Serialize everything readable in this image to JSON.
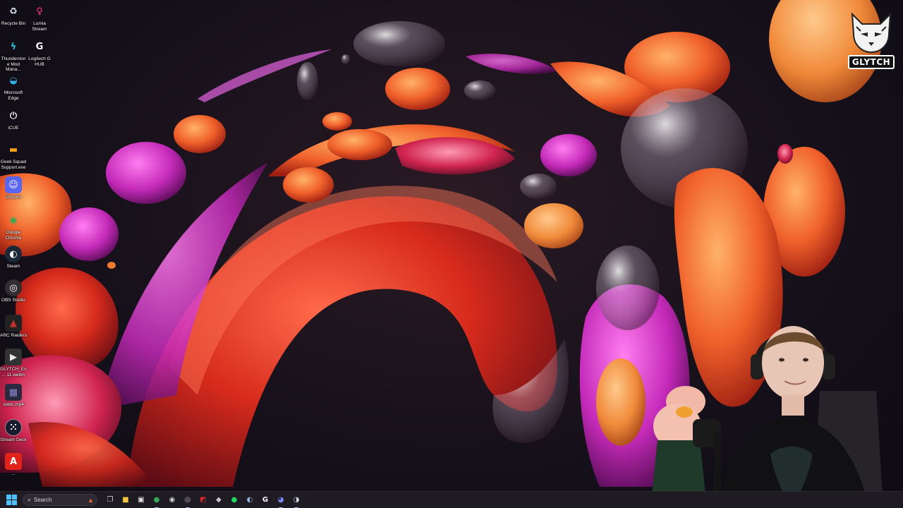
{
  "desktop": {
    "icons": [
      {
        "id": "recycle-bin",
        "label": "Recycle Bin",
        "icon": "recycle-bin-icon",
        "color": "#d9e4ef"
      },
      {
        "id": "lumia-stream",
        "label": "Lumia Stream",
        "icon": "lumia-icon",
        "color": "#ff3d7f"
      },
      {
        "id": "thunderstore",
        "label": "Thunderstore Mod Mana...",
        "icon": "thunderstore-icon",
        "color": "#23c7e0"
      },
      {
        "id": "logitech-g-hub",
        "label": "Logitech G HUB",
        "icon": "logitech-g-icon",
        "color": "#ffffff"
      },
      {
        "id": "microsoft-edge",
        "label": "Microsoft Edge",
        "icon": "edge-icon",
        "color": "#2fb1e8"
      },
      {
        "id": "icue",
        "label": "iCUE",
        "icon": "icue-icon",
        "color": "#e4e4e4"
      },
      {
        "id": "geek-squad",
        "label": "Geek Squad Support.exe",
        "icon": "geek-squad-icon",
        "color": "#f2a11b"
      },
      {
        "id": "discord",
        "label": "Discord",
        "icon": "discord-icon",
        "color": "#5865f2"
      },
      {
        "id": "google-chrome",
        "label": "Google Chrome",
        "icon": "chrome-icon",
        "color": "#34a853"
      },
      {
        "id": "steam",
        "label": "Steam",
        "icon": "steam-icon",
        "color": "#1b2838"
      },
      {
        "id": "obs-studio",
        "label": "OBS Studio",
        "icon": "obs-icon",
        "color": "#302e31"
      },
      {
        "id": "arc-raiders",
        "label": "ARC Raiders",
        "icon": "arc-raiders-icon",
        "color": "#c9302c"
      },
      {
        "id": "glytch-file",
        "label": "GLYTCH_En... 11.webm",
        "icon": "video-file-icon",
        "color": "#e8e8e8"
      },
      {
        "id": "static-file",
        "label": "static.mp4",
        "icon": "video-file-icon",
        "color": "#8a88c9"
      },
      {
        "id": "stream-deck",
        "label": "Stream Deck",
        "icon": "stream-deck-icon",
        "color": "#1a1a2e"
      },
      {
        "id": "acrobat",
        "label": "...",
        "icon": "acrobat-icon",
        "color": "#e2231a"
      }
    ]
  },
  "logo": {
    "wordmark": "GLYTCH"
  },
  "taskbar": {
    "search_label": "Search",
    "apps": [
      {
        "name": "task-view",
        "icon": "task-view-icon",
        "glyph": "❐",
        "color": "#d0d0d0",
        "active": false
      },
      {
        "name": "file-explorer",
        "icon": "folder-icon",
        "glyph": "■",
        "color": "#f4c542",
        "active": false
      },
      {
        "name": "microsoft-store",
        "icon": "store-icon",
        "glyph": "▣",
        "color": "#e8e8e8",
        "active": false
      },
      {
        "name": "chrome",
        "icon": "chrome-icon",
        "glyph": "●",
        "color": "#34a853",
        "active": true
      },
      {
        "name": "icue",
        "icon": "icue-icon",
        "glyph": "◉",
        "color": "#cfcfcf",
        "active": false
      },
      {
        "name": "obs",
        "icon": "obs-icon",
        "glyph": "◎",
        "color": "#bbbbbb",
        "active": true
      },
      {
        "name": "amd",
        "icon": "amd-icon",
        "glyph": "◩",
        "color": "#e3262e",
        "active": false
      },
      {
        "name": "adobe",
        "icon": "adobe-icon",
        "glyph": "◆",
        "color": "#c7c7c7",
        "active": false
      },
      {
        "name": "spotify",
        "icon": "spotify-icon",
        "glyph": "●",
        "color": "#1ed760",
        "active": false
      },
      {
        "name": "steam",
        "icon": "steam-icon",
        "glyph": "◐",
        "color": "#9ab7d9",
        "active": false
      },
      {
        "name": "logitech",
        "icon": "logitech-g-icon",
        "glyph": "G",
        "color": "#ffffff",
        "active": false
      },
      {
        "name": "discord",
        "icon": "discord-icon",
        "glyph": "◕",
        "color": "#7f8cff",
        "active": true
      },
      {
        "name": "steam-2",
        "icon": "steam-icon",
        "glyph": "◑",
        "color": "#cfd8e6",
        "active": true
      }
    ]
  }
}
